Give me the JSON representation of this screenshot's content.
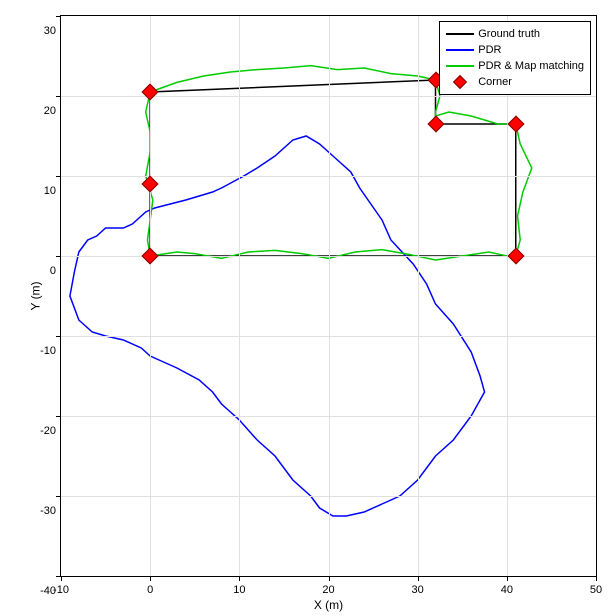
{
  "chart_data": {
    "type": "line",
    "xlabel": "X (m)",
    "ylabel": "Y (m)",
    "xlim": [
      -10,
      50
    ],
    "ylim": [
      -40,
      30
    ],
    "xticks": [
      -10,
      0,
      10,
      20,
      30,
      40,
      50
    ],
    "yticks": [
      -40,
      -30,
      -20,
      -10,
      0,
      10,
      20,
      30
    ],
    "series": [
      {
        "name": "Ground truth",
        "color": "#000000",
        "points": [
          [
            0,
            0
          ],
          [
            41,
            0
          ],
          [
            41,
            16.5
          ],
          [
            32,
            16.5
          ],
          [
            32,
            22
          ],
          [
            0,
            20.5
          ],
          [
            0,
            0
          ]
        ]
      },
      {
        "name": "PDR",
        "color": "#0000ff",
        "points": [
          [
            8,
            8.5
          ],
          [
            10.5,
            10
          ],
          [
            12,
            11
          ],
          [
            14,
            12.5
          ],
          [
            16,
            14.5
          ],
          [
            17.5,
            15
          ],
          [
            19,
            14
          ],
          [
            20.5,
            12.5
          ],
          [
            22.5,
            10.5
          ],
          [
            23.5,
            8.5
          ],
          [
            26,
            4.5
          ],
          [
            27,
            2
          ],
          [
            29.5,
            -1
          ],
          [
            31,
            -3.5
          ],
          [
            32,
            -6
          ],
          [
            34,
            -8.5
          ],
          [
            36,
            -12
          ],
          [
            37,
            -15
          ],
          [
            37.5,
            -17
          ],
          [
            36,
            -20
          ],
          [
            34,
            -23
          ],
          [
            32,
            -25
          ],
          [
            30,
            -28
          ],
          [
            28,
            -30
          ],
          [
            26,
            -31
          ],
          [
            24,
            -32
          ],
          [
            22,
            -32.5
          ],
          [
            20.5,
            -32.5
          ],
          [
            19,
            -31.5
          ],
          [
            18,
            -30
          ],
          [
            16,
            -28
          ],
          [
            14,
            -25
          ],
          [
            12,
            -23
          ],
          [
            10,
            -20.5
          ],
          [
            8,
            -18.5
          ],
          [
            7,
            -17
          ],
          [
            5.5,
            -15.5
          ],
          [
            3,
            -14
          ],
          [
            2,
            -13.5
          ],
          [
            0,
            -12.5
          ],
          [
            -1,
            -11.5
          ],
          [
            -3,
            -10.5
          ],
          [
            -5,
            -10
          ],
          [
            -6.5,
            -9.5
          ],
          [
            -8,
            -8
          ],
          [
            -9,
            -5
          ],
          [
            -8.5,
            -2
          ],
          [
            -8,
            0.5
          ],
          [
            -7,
            2
          ],
          [
            -6,
            2.5
          ],
          [
            -5,
            3.5
          ],
          [
            -4,
            3.5
          ],
          [
            -3,
            3.5
          ],
          [
            -2,
            4
          ],
          [
            -0.5,
            5.5
          ],
          [
            0.5,
            6
          ],
          [
            4,
            7
          ],
          [
            7,
            8
          ],
          [
            8,
            8.5
          ]
        ]
      },
      {
        "name": "PDR & Map matching",
        "color": "#00cc00",
        "points": [
          [
            0,
            0
          ],
          [
            3,
            0.5
          ],
          [
            5,
            0.3
          ],
          [
            8,
            -0.3
          ],
          [
            11,
            0.5
          ],
          [
            14,
            0.7
          ],
          [
            17,
            0.3
          ],
          [
            20,
            -0.3
          ],
          [
            23,
            0.5
          ],
          [
            26,
            0.8
          ],
          [
            29,
            0.2
          ],
          [
            32,
            -0.5
          ],
          [
            35,
            0
          ],
          [
            38,
            0.5
          ],
          [
            40,
            0
          ],
          [
            41,
            0
          ],
          [
            41.5,
            2
          ],
          [
            41.2,
            5
          ],
          [
            41.8,
            8
          ],
          [
            42.8,
            11
          ],
          [
            41.5,
            14
          ],
          [
            41,
            16.5
          ],
          [
            39,
            16.5
          ],
          [
            36,
            17.5
          ],
          [
            33.5,
            18
          ],
          [
            32,
            17.5
          ],
          [
            32,
            16.5
          ],
          [
            32,
            18
          ],
          [
            32.5,
            20
          ],
          [
            32,
            22
          ],
          [
            30,
            22.5
          ],
          [
            27,
            22.8
          ],
          [
            24,
            23.5
          ],
          [
            21,
            23.3
          ],
          [
            18,
            23.8
          ],
          [
            15,
            23.5
          ],
          [
            12,
            23.3
          ],
          [
            9,
            23
          ],
          [
            6,
            22.5
          ],
          [
            3,
            21.7
          ],
          [
            0,
            20.5
          ],
          [
            0,
            20.5
          ],
          [
            -0.5,
            18
          ],
          [
            0,
            15.5
          ],
          [
            0,
            13
          ],
          [
            -0.5,
            10
          ],
          [
            0.3,
            7
          ],
          [
            0,
            4.5
          ],
          [
            -0.3,
            2
          ],
          [
            0,
            0
          ]
        ]
      }
    ],
    "markers": {
      "name": "Corner",
      "color": "#ff0000",
      "shape": "diamond",
      "points": [
        [
          0,
          0
        ],
        [
          41,
          0
        ],
        [
          41,
          16.5
        ],
        [
          32,
          16.5
        ],
        [
          32,
          22
        ],
        [
          0,
          20.5
        ],
        [
          0,
          9
        ]
      ]
    },
    "legend": {
      "entries": [
        "Ground truth",
        "PDR",
        "PDR & Map matching",
        "Corner"
      ]
    }
  }
}
